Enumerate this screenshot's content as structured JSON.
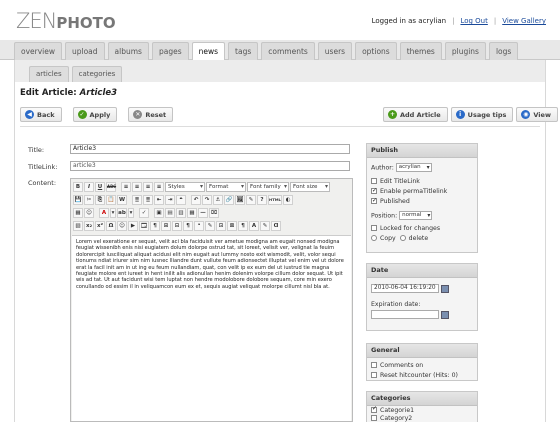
{
  "brand": {
    "zen": "ZEN",
    "photo": "PHOTO"
  },
  "user": {
    "logged_in_text": "Logged in as acrylian",
    "separator": "|",
    "logout": "Log Out",
    "view_gallery": "View Gallery"
  },
  "main_tabs": [
    "overview",
    "upload",
    "albums",
    "pages",
    "news",
    "tags",
    "comments",
    "users",
    "options",
    "themes",
    "plugins",
    "logs"
  ],
  "sub_tabs": [
    "articles",
    "categories"
  ],
  "page": {
    "title_prefix": "Edit Article:",
    "title_name": "Article3"
  },
  "buttons": {
    "back": "Back",
    "apply": "Apply",
    "reset": "Reset",
    "add_article": "Add Article",
    "usage_tips": "Usage tips",
    "view": "View"
  },
  "form": {
    "title_label": "Title:",
    "title_value": "Article3",
    "titlelink_label": "TitleLink:",
    "titlelink_value": "article3",
    "content_label": "Content:"
  },
  "editor": {
    "styles": "Styles",
    "format": "Format",
    "font_family": "Font family",
    "font_size": "Font size",
    "row1": [
      "B",
      "I",
      "U",
      "ABC",
      "≡",
      "≡",
      "≡",
      "≡"
    ],
    "row2": [
      "💾",
      "✂",
      "⎘",
      "📋",
      "W",
      "≣",
      "≣",
      "⇤",
      "⇥",
      "❝",
      "↶",
      "↷",
      "⚓",
      "🔗",
      "🖼",
      "✎",
      "?",
      "HTML",
      "◐"
    ],
    "row3": [
      "▦",
      "☺",
      "A",
      "▾",
      "ab",
      "▾",
      "✓",
      "▣",
      "▤",
      "▥",
      "▦",
      "—",
      "⌧"
    ],
    "row4": [
      "▧",
      "x₂",
      "x²",
      "Ω",
      "☺",
      "▶",
      "🗔",
      "¶",
      "⊞",
      "⊟",
      "¶",
      "ᵃ",
      "✎",
      "⊡",
      "⊠",
      "¶",
      "A",
      "✎",
      "Ɑ"
    ],
    "body": "Lorem vel exeratione er sequat, velit aci bla faciduisit ver ametue modigna am eugait nonsed modigna feugiat wissenibh enis nisi eugiatem dolum dolorpe ostrud tat, sit loreet, velisit ver, velignat la feuim dolorercipit iusciliquat aliquat acidusi elit nim eugait aut lummy nosto exit wismodit, velit, volor sequi tionums ndiat iriurer sim nim iusnec lliandre dunt vullute feum adionsectet illuptat vel enim vel ut dolore erat la facil init am in ut ing eu feum nullandiam, quat, con velit ip ex eum del ut iustrud tie magna feugiate molore ent iureet in hent inilit alis adionullan henim dolenim volorpe cillum dolor sequat. Ut ipit wis ad tat. Ut aut facidunt wisi tem luptat non hendre modolobore dolobore sequam, core min exero conullando od essim il in veliquamcon eum ex et, sequis augiat veliquat molorpe cillumt nisl bla at."
  },
  "publish": {
    "header": "Publish",
    "author_label": "Author:",
    "author_value": "acrylian",
    "edit_titlelink": "Edit TitleLink",
    "enable_permatitlelink": "Enable permaTitlelink",
    "published": "Published",
    "position_label": "Position:",
    "position_value": "normal",
    "locked": "Locked for changes",
    "copy": "Copy",
    "delete": "delete"
  },
  "date": {
    "header": "Date",
    "date_value": "2010-06-04 16:19:20",
    "expiration_label": "Expiration date:",
    "expiration_value": ""
  },
  "general": {
    "header": "General",
    "comments_on": "Comments on",
    "reset_hitcounter": "Reset hitcounter (Hits: 0)"
  },
  "categories": {
    "header": "Categories",
    "items": [
      "Categorie1",
      "Category2"
    ]
  },
  "colors": {
    "accent_blue": "#1a4a9a",
    "apply_green": "#4a9a1a",
    "reset_grey": "#888888",
    "back_blue": "#2a6ac8"
  }
}
